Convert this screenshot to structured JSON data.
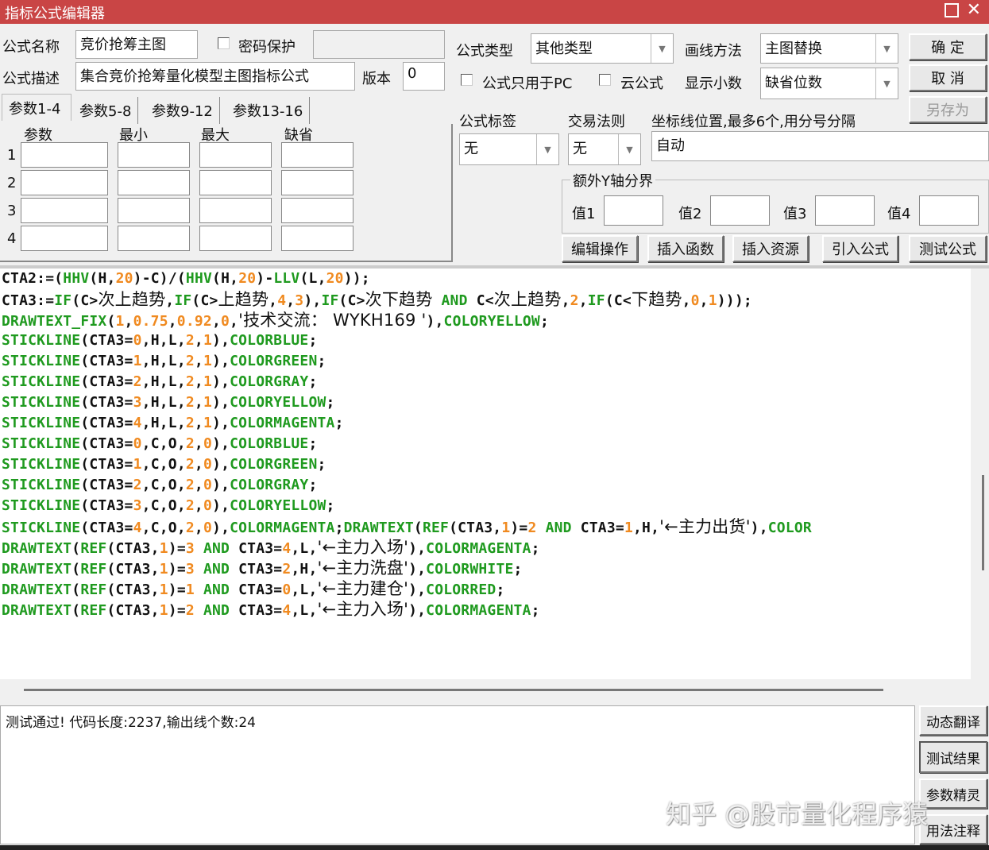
{
  "window": {
    "title": "指标公式编辑器"
  },
  "form": {
    "name_label": "公式名称",
    "name_value": "竞价抢筹主图",
    "password_label": "密码保护",
    "desc_label": "公式描述",
    "desc_value": "集合竞价抢筹量化模型主图指标公式",
    "version_label": "版本",
    "version_value": "0",
    "type_label": "公式类型",
    "type_value": "其他类型",
    "draw_label": "画线方法",
    "draw_value": "主图替换",
    "pc_only_label": "公式只用于PC",
    "cloud_label": "云公式",
    "decimals_label": "显示小数",
    "decimals_value": "缺省位数",
    "tag_label": "公式标签",
    "tag_value": "无",
    "trade_label": "交易法则",
    "trade_value": "无",
    "axis_label": "坐标线位置,最多6个,用分号分隔",
    "axis_value": "自动",
    "yaxis_group": "额外Y轴分界",
    "yvals": [
      "值1",
      "值2",
      "值3",
      "值4"
    ]
  },
  "buttons": {
    "ok": "确  定",
    "cancel": "取  消",
    "save_as": "另存为",
    "edit_ops": "编辑操作",
    "insert_func": "插入函数",
    "insert_res": "插入资源",
    "import": "引入公式",
    "test": "测试公式",
    "dyn_translate": "动态翻译",
    "test_result": "测试结果",
    "param_wizard": "参数精灵",
    "usage": "用法注释"
  },
  "tabs": [
    "参数1-4",
    "参数5-8",
    "参数9-12",
    "参数13-16"
  ],
  "params": {
    "headers": [
      "参数",
      "最小",
      "最大",
      "缺省"
    ],
    "rows": [
      "1",
      "2",
      "3",
      "4"
    ]
  },
  "code_lines": [
    "CTA2:=(HHV(H,20)-C)/(HHV(H,20)-LLV(L,20));",
    "CTA3:=IF(C>次上趋势,IF(C>上趋势,4,3),IF(C>次下趋势 AND C<次上趋势,2,IF(C<下趋势,0,1)));",
    "DRAWTEXT_FIX(1,0.75,0.92,0,'技术交流： WYKH169 '),COLORYELLOW;",
    "STICKLINE(CTA3=0,H,L,2,1),COLORBLUE;",
    "STICKLINE(CTA3=1,H,L,2,1),COLORGREEN;",
    "STICKLINE(CTA3=2,H,L,2,1),COLORGRAY;",
    "STICKLINE(CTA3=3,H,L,2,1),COLORYELLOW;",
    "STICKLINE(CTA3=4,H,L,2,1),COLORMAGENTA;",
    "STICKLINE(CTA3=0,C,O,2,0),COLORBLUE;",
    "STICKLINE(CTA3=1,C,O,2,0),COLORGREEN;",
    "STICKLINE(CTA3=2,C,O,2,0),COLORGRAY;",
    "STICKLINE(CTA3=3,C,O,2,0),COLORYELLOW;",
    "STICKLINE(CTA3=4,C,O,2,0),COLORMAGENTA;DRAWTEXT(REF(CTA3,1)=2 AND CTA3=1,H,'←主力出货'),COLOR",
    "DRAWTEXT(REF(CTA3,1)=3 AND CTA3=4,L,'←主力入场'),COLORMAGENTA;",
    "DRAWTEXT(REF(CTA3,1)=3 AND CTA3=2,H,'←主力洗盘'),COLORWHITE;",
    "DRAWTEXT(REF(CTA3,1)=1 AND CTA3=0,L,'←主力建仓'),COLORRED;",
    "DRAWTEXT(REF(CTA3,1)=2 AND CTA3=4,L,'←主力入场'),COLORMAGENTA;"
  ],
  "output": {
    "text": "测试通过! 代码长度:2237,输出线个数:24"
  },
  "watermark": "知乎 @股市量化程序猿"
}
